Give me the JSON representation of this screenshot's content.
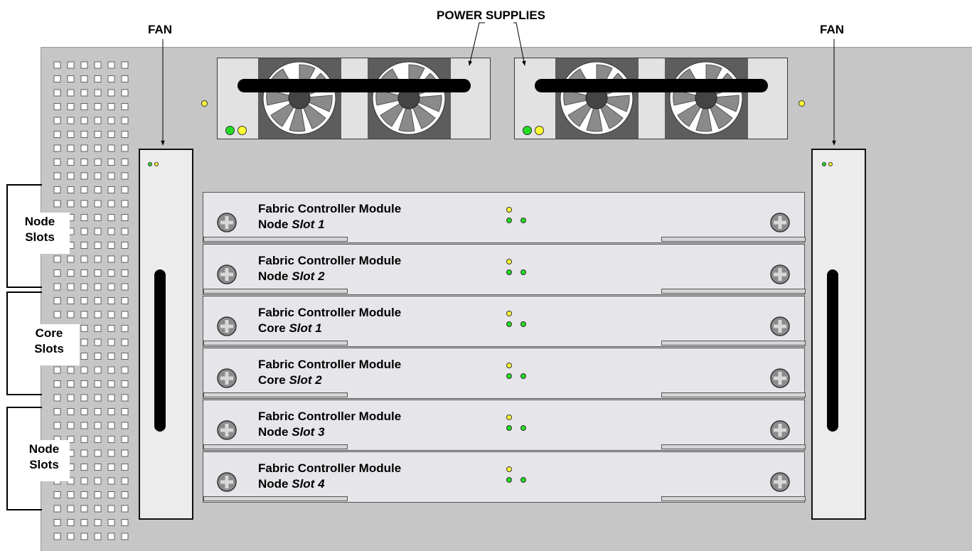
{
  "labels": {
    "fan_left": "FAN",
    "fan_right": "FAN",
    "power_supplies": "POWER SUPPLIES"
  },
  "side_groups": [
    {
      "line1": "Node",
      "line2": "Slots"
    },
    {
      "line1": "Core",
      "line2": "Slots"
    },
    {
      "line1": "Node",
      "line2": "Slots"
    }
  ],
  "modules": [
    {
      "title": "Fabric Controller Module",
      "type": "Node",
      "slot": "Slot 1"
    },
    {
      "title": "Fabric Controller Module",
      "type": "Node",
      "slot": "Slot 2"
    },
    {
      "title": "Fabric Controller Module",
      "type": "Core",
      "slot": "Slot 1"
    },
    {
      "title": "Fabric Controller Module",
      "type": "Core",
      "slot": "Slot 2"
    },
    {
      "title": "Fabric Controller Module",
      "type": "Node",
      "slot": "Slot 3"
    },
    {
      "title": "Fabric Controller Module",
      "type": "Node",
      "slot": "Slot 4"
    }
  ],
  "colors": {
    "led_yellow": "#ffff33",
    "led_green": "#22dd22",
    "chassis": "#c6c6c6"
  }
}
